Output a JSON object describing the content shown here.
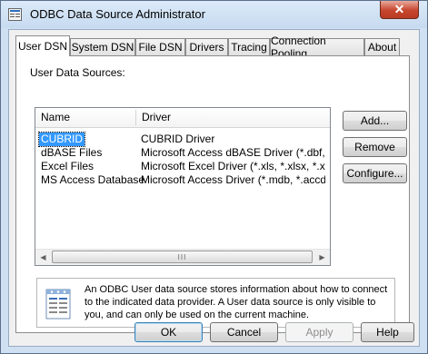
{
  "window": {
    "title": "ODBC Data Source Administrator",
    "close_label": "✕"
  },
  "tabs": [
    {
      "label": "User DSN",
      "active": true
    },
    {
      "label": "System DSN",
      "active": false
    },
    {
      "label": "File DSN",
      "active": false
    },
    {
      "label": "Drivers",
      "active": false
    },
    {
      "label": "Tracing",
      "active": false
    },
    {
      "label": "Connection Pooling",
      "active": false
    },
    {
      "label": "About",
      "active": false
    }
  ],
  "panel": {
    "list_label": "User Data Sources:",
    "columns": [
      "Name",
      "Driver"
    ],
    "rows": [
      {
        "name": "CUBRID",
        "driver": "CUBRID Driver",
        "selected": true
      },
      {
        "name": "dBASE Files",
        "driver": "Microsoft Access dBASE Driver (*.dbf, *.ndx",
        "selected": false
      },
      {
        "name": "Excel Files",
        "driver": "Microsoft Excel Driver (*.xls, *.xlsx, *.xlsm, *.x",
        "selected": false
      },
      {
        "name": "MS Access Database",
        "driver": "Microsoft Access Driver (*.mdb, *.accdb)",
        "selected": false
      }
    ],
    "scroll": {
      "left_arrow": "◀",
      "right_arrow": "▶",
      "thumb_grip": "III"
    },
    "buttons": {
      "add": "Add...",
      "remove": "Remove",
      "configure": "Configure..."
    },
    "info_text": "An ODBC User data source stores information about how to connect to the indicated data provider.  A User data source is only visible to you, and can only be used on the current machine."
  },
  "footer": {
    "ok": "OK",
    "cancel": "Cancel",
    "apply": "Apply",
    "help": "Help"
  }
}
